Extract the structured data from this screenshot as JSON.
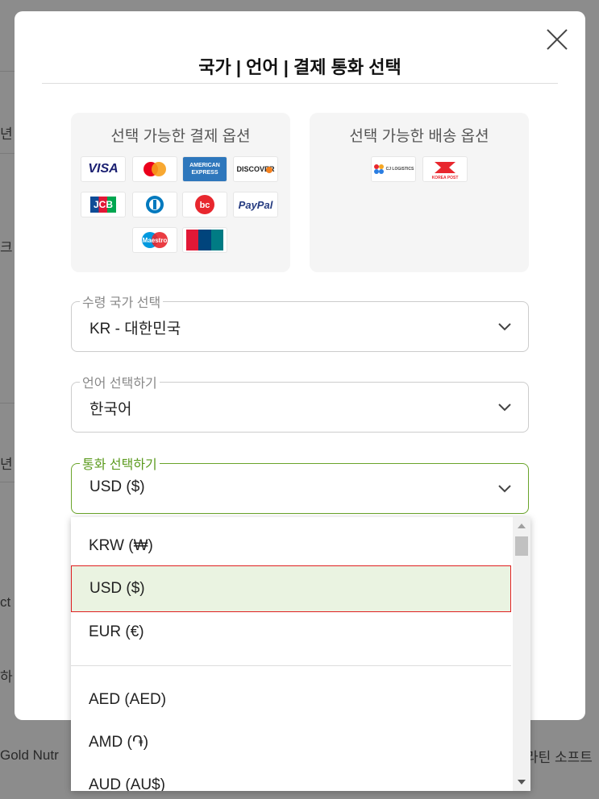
{
  "modal": {
    "title": "국가 | 언어 | 결제 통화 선택"
  },
  "payment_options": {
    "title": "선택 가능한 결제 옵션",
    "logos": [
      "VISA",
      "Mastercard",
      "AMERICAN EXPRESS",
      "DISCOVER",
      "JCB",
      "Diners Club",
      "BC",
      "PayPal",
      "Maestro",
      "UnionPay"
    ]
  },
  "shipping_options": {
    "title": "선택 가능한 배송 옵션",
    "logos": [
      "CJ LOGISTICS",
      "KOREA POST"
    ]
  },
  "country_select": {
    "label": "수령 국가 선택",
    "value": "KR - 대한민국"
  },
  "language_select": {
    "label": "언어 선택하기",
    "value": "한국어"
  },
  "currency_select": {
    "label": "통화 선택하기",
    "value": "USD ($)"
  },
  "currency_options": {
    "krw": "KRW (₩)",
    "usd": "USD ($)",
    "eur": "EUR (€)",
    "aed": "AED (AED)",
    "amd": "AMD (֏)",
    "aud": "AUD (AU$)"
  },
  "background": {
    "left_snippets": [
      "년",
      "크",
      "년",
      "ct",
      "하"
    ],
    "bottom_left": "Gold Nutr",
    "bottom_right": "라틴 소프트"
  },
  "colors": {
    "accent_green": "#6aa42a",
    "selected_bg": "#eaf3e1",
    "highlight_border": "#e02020"
  }
}
